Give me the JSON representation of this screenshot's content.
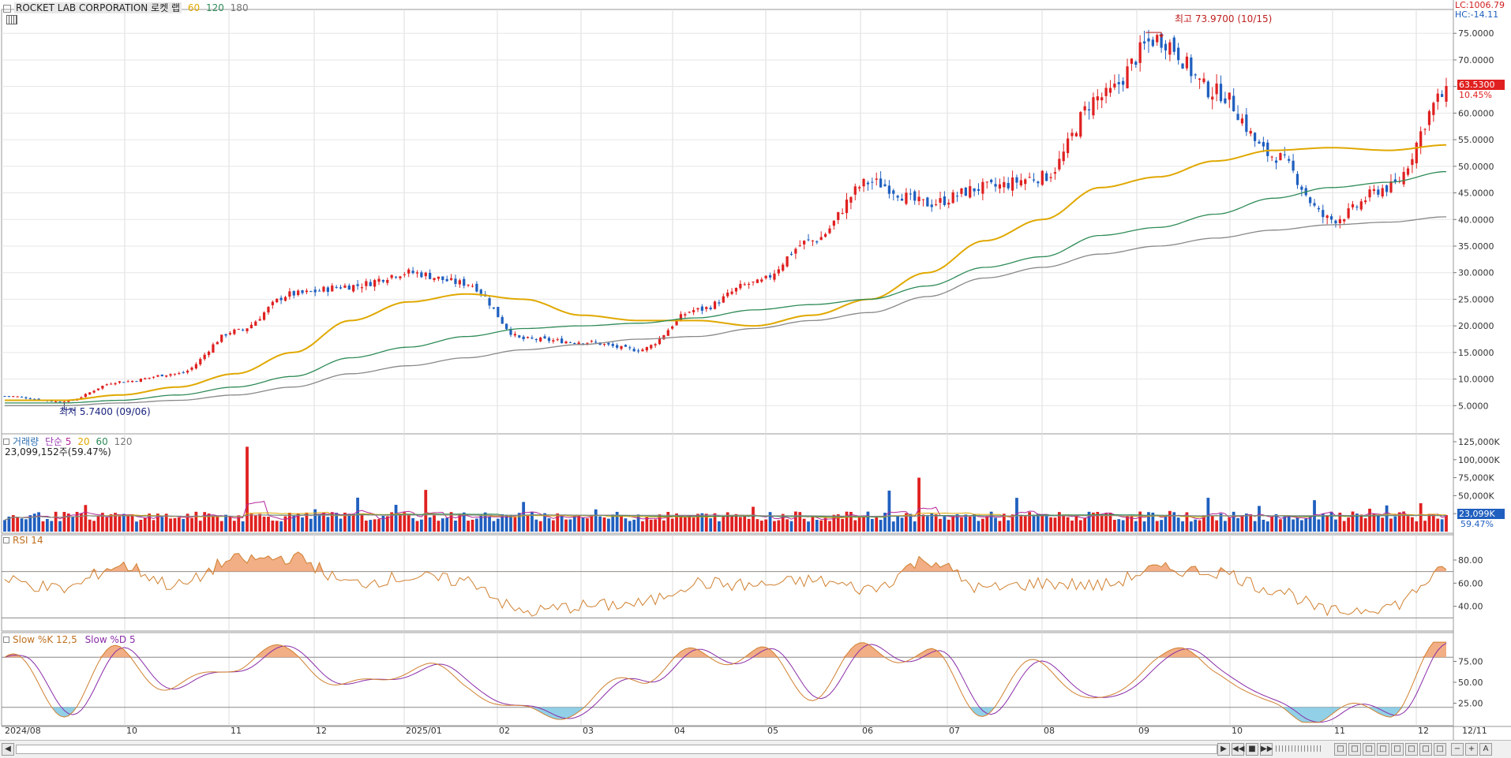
{
  "header": {
    "title": "ROCKET LAB CORPORATION  로켓 랩",
    "ma_labels": [
      {
        "text": "60",
        "color": "#e0a800"
      },
      {
        "text": "120",
        "color": "#2e8b57"
      },
      {
        "text": "180",
        "color": "#777777"
      }
    ],
    "lc": "LC:1006.79",
    "hc": "HC:-14.11"
  },
  "price_pane": {
    "high_annotation": "최고 73.9700 (10/15)",
    "low_annotation": "최저 5.7400 (09/06)",
    "last_price": "63.5300",
    "change_pct": "10.45%",
    "y_ticks": [
      "75.0000",
      "70.0000",
      "65.0000",
      "60.0000",
      "55.0000",
      "50.0000",
      "45.0000",
      "40.0000",
      "35.0000",
      "30.0000",
      "25.0000",
      "20.0000",
      "15.0000",
      "10.0000",
      "5.0000"
    ]
  },
  "volume_pane": {
    "legend": [
      {
        "text": "거래량",
        "color": "#2c6fb0"
      },
      {
        "text": "단순",
        "color": "#9b3ab3"
      },
      {
        "text": "5",
        "color": "#b5299a"
      },
      {
        "text": "20",
        "color": "#e0a800"
      },
      {
        "text": "60",
        "color": "#2e8b57"
      },
      {
        "text": "120",
        "color": "#777777"
      }
    ],
    "info": "23,099,152주(59.47%)",
    "y_ticks": [
      "125,000K",
      "100,000K",
      "75,000K",
      "50,000K",
      "25,000K"
    ],
    "last_value": "23,099K",
    "last_pct": "59.47%"
  },
  "rsi_pane": {
    "legend": "RSI 14",
    "y_ticks": [
      "80.00",
      "60.00",
      "40.00"
    ]
  },
  "stoch_pane": {
    "legend_k": "Slow %K 12,5",
    "legend_d": "Slow %D 5",
    "y_ticks": [
      "75.00",
      "50.00",
      "25.00"
    ]
  },
  "x_axis": {
    "labels": [
      "2024/08",
      "10",
      "11",
      "12",
      "2025/01",
      "02",
      "03",
      "04",
      "05",
      "06",
      "07",
      "08",
      "09",
      "10",
      "11",
      "12",
      "12/11"
    ]
  },
  "colors": {
    "up": "#e02020",
    "down": "#1f5fbf",
    "ma60": "#e0a800",
    "ma120": "#2e8b57",
    "ma180": "#888888"
  },
  "chart_data": [
    {
      "type": "candlestick",
      "title": "ROCKET LAB CORPORATION  로켓 랩",
      "x": [
        "2024/08",
        "10",
        "11",
        "12",
        "2025/01",
        "02",
        "03",
        "04",
        "05",
        "06",
        "07",
        "08",
        "09",
        "10",
        "11",
        "12"
      ],
      "close_anchors": [
        {
          "date": "2024/08",
          "close": 6.8
        },
        {
          "date": "09/06",
          "close": 5.74
        },
        {
          "date": "10",
          "close": 9.5
        },
        {
          "date": "11",
          "close": 11.0
        },
        {
          "date": "11 mid",
          "close": 19.0
        },
        {
          "date": "12",
          "close": 26.0
        },
        {
          "date": "2025/01",
          "close": 27.5
        },
        {
          "date": "01 late",
          "close": 30.0
        },
        {
          "date": "02",
          "close": 28.0
        },
        {
          "date": "03",
          "close": 17.5
        },
        {
          "date": "04",
          "close": 17.0
        },
        {
          "date": "04 mid",
          "close": 15.5
        },
        {
          "date": "05",
          "close": 23.0
        },
        {
          "date": "06",
          "close": 28.0
        },
        {
          "date": "06 late",
          "close": 36.0
        },
        {
          "date": "07",
          "close": 47.0
        },
        {
          "date": "08",
          "close": 43.0
        },
        {
          "date": "09",
          "close": 46.0
        },
        {
          "date": "09 late",
          "close": 48.0
        },
        {
          "date": "10",
          "close": 63.0
        },
        {
          "date": "10/15",
          "close": 73.97
        },
        {
          "date": "10 late",
          "close": 64.0
        },
        {
          "date": "11",
          "close": 52.0
        },
        {
          "date": "11 late",
          "close": 40.0
        },
        {
          "date": "12",
          "close": 46.0
        },
        {
          "date": "12/11",
          "close": 63.53
        }
      ],
      "ylim": [
        0,
        78
      ],
      "high": {
        "date": "10/15",
        "value": 73.97
      },
      "low": {
        "date": "09/06",
        "value": 5.74
      },
      "series": [
        {
          "name": "60",
          "values_at_anchors": [
            6.0,
            6.0,
            7.0,
            8.5,
            11.0,
            15.0,
            21.0,
            24.5,
            26.0,
            25.0,
            22.0,
            21.0,
            21.0,
            20.0,
            22.0,
            25.0,
            30.0,
            36.0,
            40.0,
            46.0,
            48.0,
            51.0,
            53.0,
            53.5,
            53.0,
            54.0
          ]
        },
        {
          "name": "120",
          "values_at_anchors": [
            5.5,
            5.5,
            6.0,
            7.0,
            8.5,
            10.5,
            14.0,
            16.0,
            18.0,
            19.5,
            20.0,
            20.5,
            21.5,
            23.0,
            24.0,
            25.0,
            27.5,
            31.0,
            33.0,
            37.0,
            38.5,
            41.0,
            44.0,
            46.0,
            47.0,
            49.0
          ]
        },
        {
          "name": "180",
          "values_at_anchors": [
            5.0,
            5.0,
            5.5,
            6.0,
            7.0,
            8.5,
            11.0,
            12.5,
            14.0,
            15.5,
            16.5,
            17.5,
            18.0,
            19.5,
            21.0,
            22.5,
            25.5,
            29.0,
            31.0,
            33.5,
            35.0,
            36.5,
            38.0,
            39.0,
            39.5,
            40.5
          ]
        }
      ]
    },
    {
      "type": "bar",
      "title": "거래량",
      "ylim": [
        0,
        125000
      ],
      "last_value_k": 23099,
      "spikes_k": [
        {
          "date": "11 mid",
          "value": 118000
        },
        {
          "date": "01 late",
          "value": 60000
        },
        {
          "date": "06 late",
          "value": 60000
        },
        {
          "date": "07",
          "value": 75000
        }
      ]
    },
    {
      "type": "line",
      "title": "RSI 14",
      "ylim": [
        20,
        95
      ],
      "thresholds": [
        70,
        30
      ],
      "values_at_anchors": [
        62,
        55,
        75,
        58,
        80,
        82,
        60,
        65,
        62,
        35,
        40,
        42,
        60,
        58,
        62,
        55,
        80,
        55,
        60,
        58,
        72,
        70,
        55,
        35,
        40,
        70
      ]
    },
    {
      "type": "line",
      "title": "Slow %K 12,5 / Slow %D 5",
      "ylim": [
        0,
        100
      ],
      "thresholds": [
        80,
        20
      ],
      "series": [
        {
          "name": "Slow %K 12,5",
          "values_at_anchors": [
            80,
            20,
            85,
            40,
            75,
            85,
            40,
            70,
            50,
            10,
            20,
            60,
            80,
            85,
            40,
            90,
            80,
            20,
            75,
            20,
            85,
            70,
            15,
            10,
            20,
            95
          ]
        },
        {
          "name": "Slow %D 5",
          "values_at_anchors": [
            78,
            25,
            82,
            45,
            72,
            82,
            45,
            65,
            55,
            15,
            22,
            55,
            75,
            82,
            45,
            85,
            80,
            25,
            70,
            25,
            80,
            72,
            20,
            12,
            18,
            88
          ]
        }
      ]
    }
  ]
}
